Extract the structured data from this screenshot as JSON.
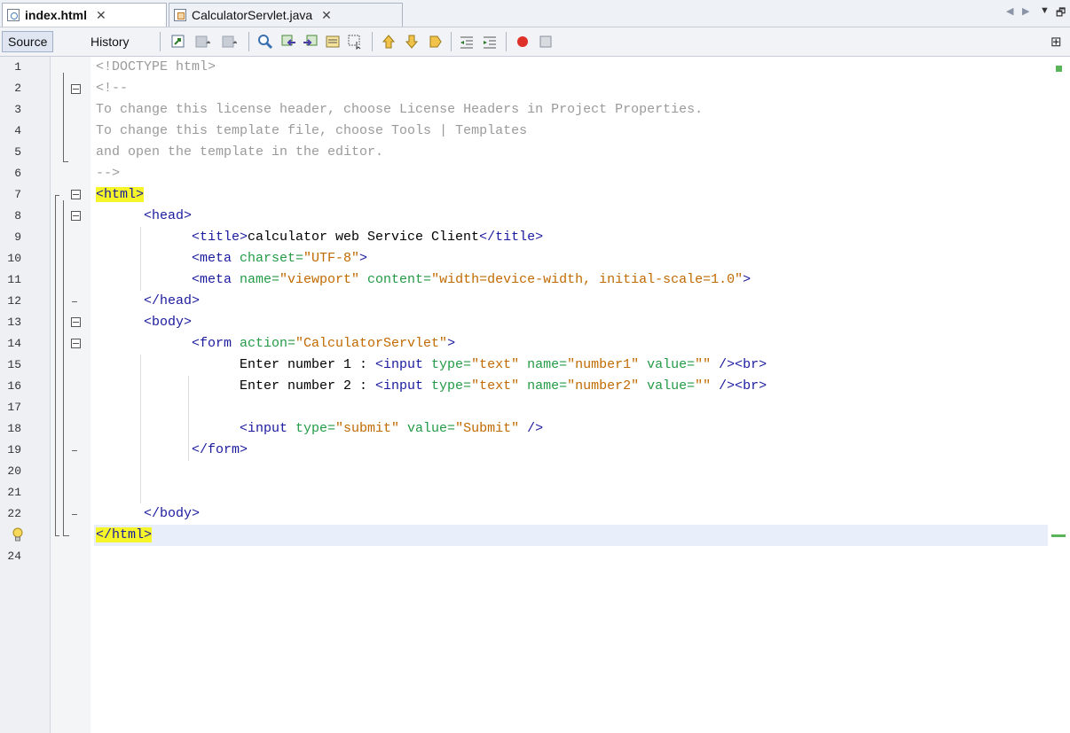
{
  "tabs": [
    {
      "label": "index.html",
      "active": true,
      "icon": "html-file-icon"
    },
    {
      "label": "CalculatorServlet.java",
      "active": false,
      "icon": "java-file-icon"
    }
  ],
  "tab_close_glyph": "✕",
  "window_controls": {
    "prev": "◀",
    "next": "▶",
    "menu": "▼",
    "restore": "🗗"
  },
  "toolbar": {
    "source_label": "Source",
    "history_label": "History",
    "split_glyph": "⊞"
  },
  "editor": {
    "line_numbers": [
      "1",
      "2",
      "3",
      "4",
      "5",
      "6",
      "7",
      "8",
      "9",
      "10",
      "11",
      "12",
      "13",
      "14",
      "15",
      "16",
      "17",
      "18",
      "19",
      "20",
      "21",
      "22",
      "",
      "24"
    ],
    "lines": {
      "l1": "<!DOCTYPE html>",
      "l2": "<!--",
      "l3": "To change this license header, choose License Headers in Project Properties.",
      "l4": "To change this template file, choose Tools | Templates",
      "l5": "and open the template in the editor.",
      "l6": "-->",
      "l7": "<html>",
      "l8": "<head>",
      "l9a": "<title>",
      "l9b": "calculator web Service Client",
      "l9c": "</title>",
      "l10a": "<meta ",
      "l10b": "charset=",
      "l10c": "\"UTF-8\"",
      "l10d": ">",
      "l11a": "<meta ",
      "l11b": "name=",
      "l11c": "\"viewport\"",
      "l11d": " content=",
      "l11e": "\"width=device-width, initial-scale=1.0\"",
      "l11f": ">",
      "l12": "</head>",
      "l13": "<body>",
      "l14a": "<form ",
      "l14b": "action=",
      "l14c": "\"CalculatorServlet\"",
      "l14d": ">",
      "l15a": "Enter number 1 : ",
      "l15b": "<input ",
      "l15c": "type=",
      "l15d": "\"text\"",
      "l15e": " name=",
      "l15f": "\"number1\"",
      "l15g": " value=",
      "l15h": "\"\"",
      "l15i": " /><br>",
      "l16a": "Enter number 2 : ",
      "l16b": "<input ",
      "l16c": "type=",
      "l16d": "\"text\"",
      "l16e": " name=",
      "l16f": "\"number2\"",
      "l16g": " value=",
      "l16h": "\"\"",
      "l16i": " /><br>",
      "l18a": "<input ",
      "l18b": "type=",
      "l18c": "\"submit\"",
      "l18d": " value=",
      "l18e": "\"Submit\"",
      "l18f": " />",
      "l19": "</form>",
      "l22": "</body>",
      "l23": "</html>"
    }
  },
  "colors": {
    "comment": "#9a9a9a",
    "tag": "#1a1a9e",
    "attribute": "#239a46",
    "attribute_value": "#c06a00",
    "highlight": "#f5f52a",
    "current_line": "#e9effa"
  }
}
